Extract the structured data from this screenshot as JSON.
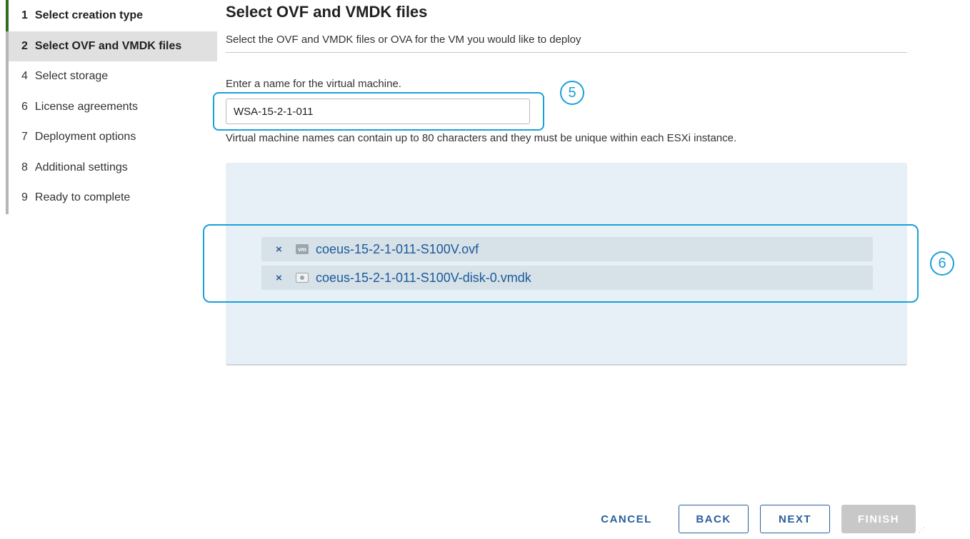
{
  "sidebar": {
    "steps": [
      {
        "num": "1",
        "label": "Select creation type"
      },
      {
        "num": "2",
        "label": "Select OVF and VMDK files"
      },
      {
        "num": "4",
        "label": "Select storage"
      },
      {
        "num": "6",
        "label": "License agreements"
      },
      {
        "num": "7",
        "label": "Deployment options"
      },
      {
        "num": "8",
        "label": "Additional settings"
      },
      {
        "num": "9",
        "label": "Ready to complete"
      }
    ]
  },
  "main": {
    "title": "Select OVF and VMDK files",
    "subtitle": "Select the OVF and VMDK files or OVA for the VM you would like to deploy",
    "name_label": "Enter a name for the virtual machine.",
    "name_value": "WSA-15-2-1-011",
    "help_text": "Virtual machine names can contain up to 80 characters and they must be unique within each ESXi instance.",
    "files": [
      {
        "remove": "×",
        "icon": "vm-icon",
        "icon_text": "vm",
        "name": "coeus-15-2-1-011-S100V.ovf"
      },
      {
        "remove": "×",
        "icon": "disk-icon",
        "name": "coeus-15-2-1-011-S100V-disk-0.vmdk"
      }
    ]
  },
  "callouts": {
    "five": "5",
    "six": "6"
  },
  "footer": {
    "cancel": "CANCEL",
    "back": "BACK",
    "next": "NEXT",
    "finish": "FINISH"
  },
  "colors": {
    "accent": "#2a5f9e",
    "callout": "#1aa0d8",
    "active_step_marker": "#2f6d1e",
    "drop_zone": "#e6f0f6"
  }
}
